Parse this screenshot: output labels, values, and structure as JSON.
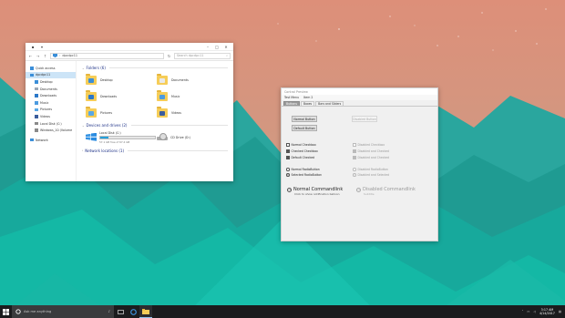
{
  "explorer": {
    "title": "dpcdpc11",
    "path": "dpcdpc11",
    "search_placeholder": "Search dpcdpc11",
    "sidebar": [
      {
        "label": "Quick access",
        "icon": "star-icon",
        "level": 0
      },
      {
        "label": "dpcdpc11",
        "icon": "computer-icon",
        "level": 0,
        "active": true
      },
      {
        "label": "Desktop",
        "icon": "desktop-icon",
        "level": 1
      },
      {
        "label": "Documents",
        "icon": "documents-icon",
        "level": 1
      },
      {
        "label": "Downloads",
        "icon": "downloads-icon",
        "level": 1
      },
      {
        "label": "Music",
        "icon": "music-icon",
        "level": 1
      },
      {
        "label": "Pictures",
        "icon": "pictures-icon",
        "level": 1
      },
      {
        "label": "Videos",
        "icon": "videos-icon",
        "level": 1
      },
      {
        "label": "Local Disk (C:)",
        "icon": "disk-icon",
        "level": 1
      },
      {
        "label": "Windows_10 (Volume",
        "icon": "disk-icon",
        "level": 1
      },
      {
        "label": "Network",
        "icon": "network-icon",
        "level": 0
      }
    ],
    "folders_header": "Folders (6)",
    "folders": [
      {
        "label": "Desktop",
        "glyph_color": "#3d8fd6"
      },
      {
        "label": "Documents",
        "glyph_color": "#e9e9e9"
      },
      {
        "label": "Downloads",
        "glyph_color": "#2b78c9"
      },
      {
        "label": "Music",
        "glyph_color": "#4c9be0"
      },
      {
        "label": "Pictures",
        "glyph_color": "#59a8e6"
      },
      {
        "label": "Videos",
        "glyph_color": "#3b5d9c"
      }
    ],
    "drives_header": "Devices and drives (2)",
    "drives": [
      {
        "label": "Local Disk (C:)",
        "free": "57.1 GB free of 67.4 GB",
        "used_fraction": 0.15
      },
      {
        "label": "CD Drive (D:)"
      }
    ],
    "network_header": "Network locations (1)"
  },
  "controls": {
    "title": "Control Preview",
    "menu": [
      "Test Menu",
      "Item 2"
    ],
    "tabs": [
      "Buttons",
      "Boxes",
      "Bars and Sliders"
    ],
    "buttons": {
      "normal": "Normal Button",
      "default": "Default Button",
      "disabled": "Disabled Button"
    },
    "checkboxes": {
      "normal": "Normal Checkbox",
      "checked": "Checked Checkbox",
      "default": "Default Checked",
      "disabled": "Disabled Checkbox",
      "disabled_checked": "Disabled and Checked",
      "disabled_checked2": "Disabled and Checked"
    },
    "radios": {
      "normal": "Normal RadioButton",
      "selected": "Selected RadioButton",
      "disabled": "Disabled RadioButton",
      "disabled_selected": "Disabled and Selected"
    },
    "commandlinks": {
      "normal": "Normal Commandlink",
      "normal_sub": "Click to show notification balloon",
      "disabled": "Disabled Commandlink",
      "disabled_sub": "Subtitle"
    }
  },
  "taskbar": {
    "search_placeholder": "Ask me anything",
    "time": "3:17 AM",
    "date": "4/14/2017"
  }
}
